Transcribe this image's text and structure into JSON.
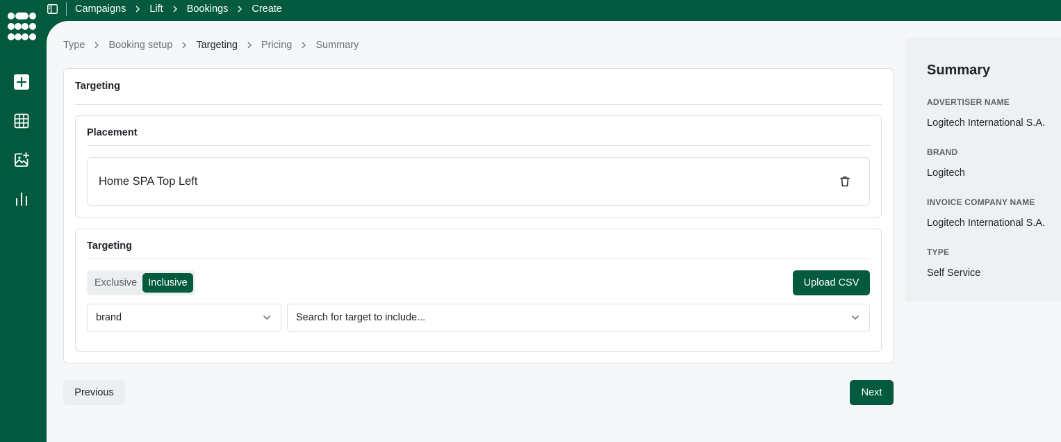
{
  "breadcrumb": {
    "items": [
      "Campaigns",
      "Lift",
      "Bookings",
      "Create"
    ]
  },
  "steps": {
    "items": [
      "Type",
      "Booking setup",
      "Targeting",
      "Pricing",
      "Summary"
    ],
    "active": "Targeting"
  },
  "sidebar": {
    "icons": [
      "plus-icon",
      "table-icon",
      "image-add-icon",
      "bar-chart-icon"
    ]
  },
  "card": {
    "title": "Targeting",
    "placement": {
      "title": "Placement",
      "item": "Home SPA Top Left"
    },
    "targeting": {
      "title": "Targeting",
      "toggle": {
        "options": [
          "Exclusive",
          "Inclusive"
        ],
        "selected": "Inclusive"
      },
      "upload_label": "Upload CSV",
      "type_select_value": "brand",
      "search_placeholder": "Search for target to include..."
    }
  },
  "actions": {
    "previous": "Previous",
    "next": "Next"
  },
  "summary": {
    "title": "Summary",
    "fields": [
      {
        "label": "ADVERTISER NAME",
        "value": "Logitech International S.A."
      },
      {
        "label": "BRAND",
        "value": "Logitech"
      },
      {
        "label": "INVOICE COMPANY NAME",
        "value": "Logitech International S.A."
      },
      {
        "label": "TYPE",
        "value": "Self Service"
      }
    ]
  },
  "colors": {
    "brand_green": "#035a3e",
    "background": "#f6f7f8",
    "summary_bg": "#eef0f1"
  }
}
